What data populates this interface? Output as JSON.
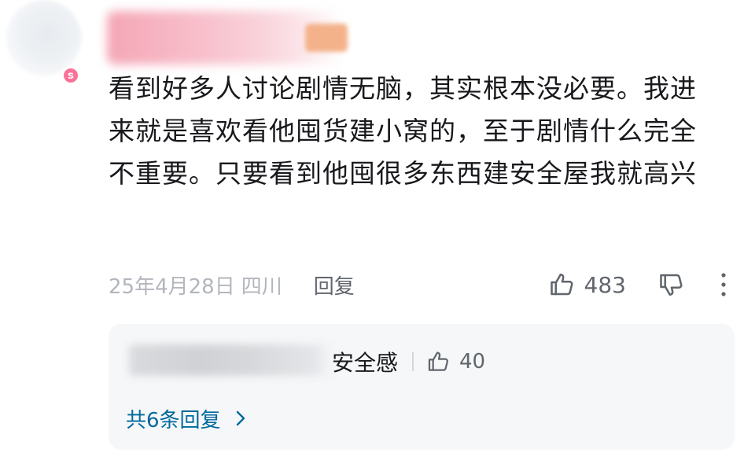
{
  "comment": {
    "badge_label": "s",
    "level_label": "5",
    "text": "看到好多人讨论剧情无脑，其实根本没必要。我进来就是喜欢看他囤货建小窝的，至于剧情什么完全不重要。只要看到他囤很多东西建安全屋我就高兴",
    "date": "25年4月28日",
    "location": "四川",
    "reply_label": "回复",
    "like_count": "483"
  },
  "reply_preview": {
    "text": "安全感",
    "like_count": "40",
    "total_replies_label": "共6条回复"
  },
  "icons": {
    "like": "thumbs-up-icon",
    "dislike": "thumbs-down-icon",
    "more": "more-vertical-icon",
    "chevron": "chevron-right-icon"
  },
  "colors": {
    "text": "#18191c",
    "secondary": "#61666d",
    "muted": "#b3b6bc",
    "link": "#00699d",
    "badge": "#fb7299",
    "reply_bg": "#f6f7f8"
  }
}
